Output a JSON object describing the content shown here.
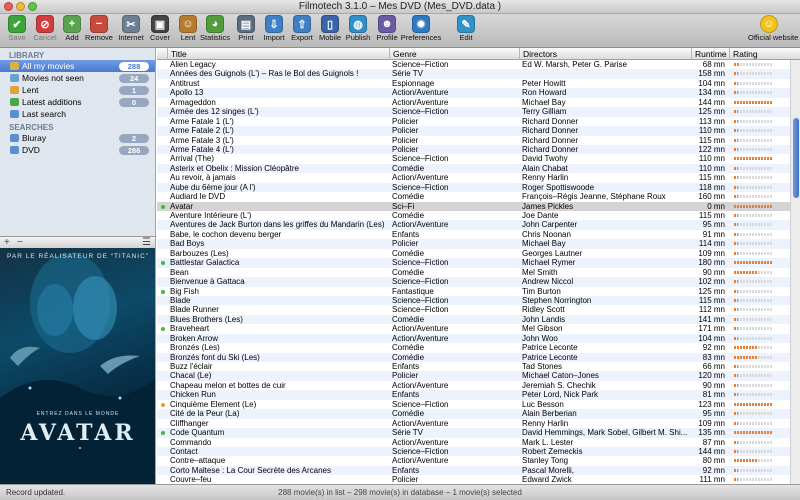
{
  "window": {
    "title": "Filmotech 3.1.0 – Mes DVD (Mes_DVD.data )"
  },
  "toolbar": {
    "buttons": [
      {
        "label": "Save",
        "icon": "check-icon",
        "color": "#3aa63a",
        "glyph": "✔",
        "disabled": true
      },
      {
        "label": "Cancel",
        "icon": "cancel-icon",
        "color": "#d23c3c",
        "glyph": "⊘",
        "disabled": true
      },
      {
        "label": "Add",
        "icon": "add-icon",
        "color": "#5aa34e",
        "glyph": "+"
      },
      {
        "label": "Remove",
        "icon": "remove-icon",
        "color": "#c64b3c",
        "glyph": "−"
      },
      {
        "label": "Internet",
        "icon": "internet-icon",
        "color": "#6e7f94",
        "glyph": "✂"
      },
      {
        "label": "Cover",
        "icon": "cover-icon",
        "color": "#444444",
        "glyph": "▣"
      },
      {
        "label": "Lent",
        "icon": "lent-icon",
        "color": "#b57c2e",
        "glyph": "☺"
      },
      {
        "label": "Statistics",
        "icon": "statistics-icon",
        "color": "#4f9d3b",
        "glyph": "◕"
      },
      {
        "label": "Print",
        "icon": "print-icon",
        "color": "#5c6c7f",
        "glyph": "▤"
      },
      {
        "label": "Import",
        "icon": "import-icon",
        "color": "#3f7fc4",
        "glyph": "⇩"
      },
      {
        "label": "Export",
        "icon": "export-icon",
        "color": "#3f7fc4",
        "glyph": "⇧"
      },
      {
        "label": "Mobile",
        "icon": "mobile-icon",
        "color": "#3a63a8",
        "glyph": "▯"
      },
      {
        "label": "Publish",
        "icon": "publish-icon",
        "color": "#2e8fc9",
        "glyph": "◍"
      },
      {
        "label": "Profile",
        "icon": "profile-icon",
        "color": "#6b5aa6",
        "glyph": "☻"
      },
      {
        "label": "Preferences",
        "icon": "preferences-icon",
        "color": "#2f79c3",
        "glyph": "✹"
      },
      {
        "label": "Edit",
        "icon": "edit-icon",
        "color": "#2f93c9",
        "glyph": "✎"
      },
      {
        "label": "Official website",
        "icon": "smiley-icon",
        "color": "#f2c11d",
        "glyph": "☺"
      }
    ]
  },
  "sidebar": {
    "library_header": "LIBRARY",
    "library": [
      {
        "label": "All my movies",
        "count": "288",
        "icon": "folder-icon",
        "color": "#d7b441",
        "selected": true
      },
      {
        "label": "Movies not seen",
        "count": "24",
        "icon": "eye-icon",
        "color": "#6aa0cf"
      },
      {
        "label": "Lent",
        "count": "1",
        "icon": "lent-icon",
        "color": "#e0a040"
      },
      {
        "label": "Latest additions",
        "count": "0",
        "icon": "plus-icon",
        "color": "#48a848"
      },
      {
        "label": "Last search",
        "count": "",
        "icon": "search-icon",
        "color": "#5a8fd0"
      }
    ],
    "searches_header": "SEARCHES",
    "searches": [
      {
        "label": "Bluray",
        "count": "2",
        "icon": "search-icon",
        "color": "#5a8fd0"
      },
      {
        "label": "DVD",
        "count": "286",
        "icon": "search-icon",
        "color": "#5a8fd0"
      }
    ],
    "add_glyph": "+",
    "remove_glyph": "−",
    "menu_glyph": "☰"
  },
  "poster": {
    "tagline": "PAR LE RÉALISATEUR DE “TITANIC”",
    "subtitle": "ENTREZ DANS LE MONDE",
    "title": "AVATAR"
  },
  "table": {
    "columns": [
      "Title",
      "Genre",
      "Directors",
      "Runtime",
      "Rating"
    ],
    "rows": [
      [
        "Alien Legacy",
        "Science–Fiction",
        "Ed W. Marsh, Peter G. Parise",
        "68 mn",
        0.15,
        ""
      ],
      [
        "Années des Guignols (L') – Ras le Bol des Guignols !",
        "Série TV",
        "",
        "158 mn",
        0.1,
        ""
      ],
      [
        "Antitrust",
        "Espionnage",
        "Peter Howitt",
        "104 mn",
        0.1,
        ""
      ],
      [
        "Apollo 13",
        "Action/Aventure",
        "Ron Howard",
        "134 mn",
        0.1,
        ""
      ],
      [
        "Armageddon",
        "Action/Aventure",
        "Michael Bay",
        "144 mn",
        1.0,
        ""
      ],
      [
        "Armée des 12 singes (L')",
        "Science–Fiction",
        "Terry Gilliam",
        "125 mn",
        0.1,
        ""
      ],
      [
        "Arme Fatale 1 (L')",
        "Policier",
        "Richard Donner",
        "113 mn",
        0.1,
        ""
      ],
      [
        "Arme Fatale 2 (L')",
        "Policier",
        "Richard Donner",
        "110 mn",
        0.1,
        ""
      ],
      [
        "Arme Fatale 3 (L')",
        "Policier",
        "Richard Donner",
        "115 mn",
        0.1,
        ""
      ],
      [
        "Arme Fatale 4 (L')",
        "Policier",
        "Richard Donner",
        "122 mn",
        0.1,
        ""
      ],
      [
        "Arrival (The)",
        "Science–Fiction",
        "David Twohy",
        "110 mn",
        1.0,
        ""
      ],
      [
        "Asterix et Obelix : Mission Cléopâtre",
        "Comédie",
        "Alain Chabat",
        "110 mn",
        0.1,
        ""
      ],
      [
        "Au revoir, à jamais",
        "Action/Aventure",
        "Renny Harlin",
        "115 mn",
        0.1,
        ""
      ],
      [
        "Aube du 6ème jour (A l')",
        "Science–Fiction",
        "Roger Spottiswoode",
        "118 mn",
        0.1,
        ""
      ],
      [
        "Audiard le DVD",
        "Comédie",
        "François–Régis Jeanne, Stéphane Roux",
        "160 mn",
        0.1,
        ""
      ],
      [
        "Avatar",
        "Sci–Fi",
        "James Pickles",
        "0 mn",
        1.0,
        "green"
      ],
      [
        "Aventure Intérieure (L')",
        "Comédie",
        "Joe Dante",
        "115 mn",
        0.1,
        ""
      ],
      [
        "Aventures de Jack Burton dans les griffes du Mandarin (Les)",
        "Action/Aventure",
        "John Carpenter",
        "95 mn",
        0.1,
        ""
      ],
      [
        "Babe, le cochon devenu berger",
        "Enfants",
        "Chris Noonan",
        "91 mn",
        0.1,
        ""
      ],
      [
        "Bad Boys",
        "Policier",
        "Michael Bay",
        "114 mn",
        0.1,
        ""
      ],
      [
        "Barbouzes (Les)",
        "Comédie",
        "Georges Lautner",
        "109 mn",
        0.1,
        ""
      ],
      [
        "Battlestar Galactica",
        "Science–Fiction",
        "Michael Rymer",
        "180 mn",
        1.0,
        "green"
      ],
      [
        "Bean",
        "Comédie",
        "Mel Smith",
        "90 mn",
        0.6,
        ""
      ],
      [
        "Bienvenue à Gattaca",
        "Science–Fiction",
        "Andrew Niccol",
        "102 mn",
        0.1,
        ""
      ],
      [
        "Big Fish",
        "Fantastique",
        "Tim Burton",
        "125 mn",
        0.1,
        "green"
      ],
      [
        "Blade",
        "Science–Fiction",
        "Stephen Norrington",
        "115 mn",
        0.1,
        ""
      ],
      [
        "Blade Runner",
        "Science–Fiction",
        "Ridley Scott",
        "112 mn",
        0.1,
        ""
      ],
      [
        "Blues Brothers (Les)",
        "Comédie",
        "John Landis",
        "141 mn",
        0.1,
        ""
      ],
      [
        "Braveheart",
        "Action/Aventure",
        "Mel Gibson",
        "171 mn",
        0.1,
        "green"
      ],
      [
        "Broken Arrow",
        "Action/Aventure",
        "John Woo",
        "104 mn",
        0.1,
        ""
      ],
      [
        "Bronzés (Les)",
        "Comédie",
        "Patrice Leconte",
        "92 mn",
        0.6,
        ""
      ],
      [
        "Bronzés font du Ski (Les)",
        "Comédie",
        "Patrice Leconte",
        "83 mn",
        0.6,
        ""
      ],
      [
        "Buzz l'éclair",
        "Enfants",
        "Tad Stones",
        "66 mn",
        0.1,
        ""
      ],
      [
        "Chacal (Le)",
        "Policier",
        "Michael Caton–Jones",
        "120 mn",
        0.1,
        ""
      ],
      [
        "Chapeau melon et bottes de cuir",
        "Action/Aventure",
        "Jeremiah S. Chechik",
        "90 mn",
        0.1,
        ""
      ],
      [
        "Chicken Run",
        "Enfants",
        "Peter Lord, Nick Park",
        "81 mn",
        0.1,
        ""
      ],
      [
        "Cinquième Element (Le)",
        "Science–Fiction",
        "Luc Besson",
        "123 mn",
        1.0,
        "orange"
      ],
      [
        "Cité de la Peur (La)",
        "Comédie",
        "Alain Berberian",
        "95 mn",
        0.1,
        ""
      ],
      [
        "Cliffhanger",
        "Action/Aventure",
        "Renny Harlin",
        "109 mn",
        0.1,
        ""
      ],
      [
        "Code Quantum",
        "Série TV",
        "David Hemmings, Mark Sobel, Gilbert M. Shi...",
        "135 mn",
        1.0,
        "green"
      ],
      [
        "Commando",
        "Action/Aventure",
        "Mark L. Lester",
        "87 mn",
        0.1,
        ""
      ],
      [
        "Contact",
        "Science–Fiction",
        "Robert Zemeckis",
        "144 mn",
        0.1,
        ""
      ],
      [
        "Contre–attaque",
        "Action/Aventure",
        "Stanley Tong",
        "80 mn",
        0.6,
        ""
      ],
      [
        "Corto Maltese : La Cour Secrète des Arcanes",
        "Enfants",
        "Pascal Morelli,",
        "92 mn",
        0.1,
        ""
      ],
      [
        "Couvre–feu",
        "Policier",
        "Edward Zwick",
        "111 mn",
        0.1,
        ""
      ]
    ],
    "selected_index": 15
  },
  "status": {
    "left": "Record updated.",
    "center": "288 movie(s) in list – 298 movie(s) in database – 1 movie(s) selected"
  }
}
